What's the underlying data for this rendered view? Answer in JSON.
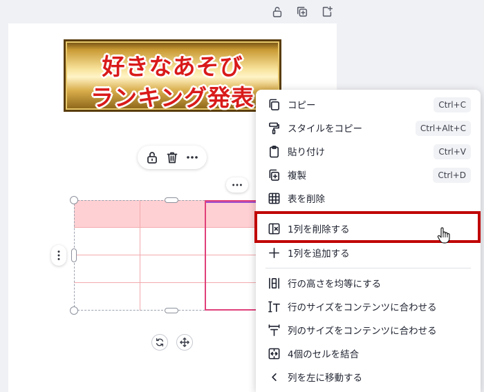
{
  "banner": {
    "line1": "好きなあそび",
    "line2": "ランキング発表"
  },
  "top_toolbar": {
    "icons": [
      "lock-icon",
      "duplicate-page-icon",
      "add-page-icon"
    ]
  },
  "element_toolbar": {
    "icons": [
      "unlock-icon",
      "trash-icon",
      "more-icon"
    ]
  },
  "table": {
    "rows": 4,
    "columns": 3,
    "header_color": "#ffd0d3",
    "grid_color": "#f2a9ad",
    "selected_column": 3
  },
  "context_menu": {
    "items": [
      {
        "label": "コピー",
        "shortcut": "Ctrl+C",
        "icon": "copy-icon"
      },
      {
        "label": "スタイルをコピー",
        "shortcut": "Ctrl+Alt+C",
        "icon": "paint-roller-icon"
      },
      {
        "label": "貼り付け",
        "shortcut": "Ctrl+V",
        "icon": "clipboard-icon"
      },
      {
        "label": "複製",
        "shortcut": "Ctrl+D",
        "icon": "duplicate-icon"
      },
      {
        "label": "表を削除",
        "shortcut": "",
        "icon": "table-grid-icon"
      },
      {
        "label": "1列を削除する",
        "shortcut": "",
        "icon": "delete-column-icon"
      },
      {
        "label": "1列を追加する",
        "shortcut": "",
        "icon": "plus-icon"
      },
      {
        "label": "行の高さを均等にする",
        "shortcut": "",
        "icon": "distribute-rows-icon"
      },
      {
        "label": "行のサイズをコンテンツに合わせる",
        "shortcut": "",
        "icon": "fit-row-icon"
      },
      {
        "label": "列のサイズをコンテンツに合わせる",
        "shortcut": "",
        "icon": "fit-column-icon"
      },
      {
        "label": "4個のセルを結合",
        "shortcut": "",
        "icon": "merge-cells-icon"
      },
      {
        "label": "列を左に移動する",
        "shortcut": "",
        "icon": "chevron-left-icon"
      }
    ],
    "highlight_color": "#c00000"
  }
}
